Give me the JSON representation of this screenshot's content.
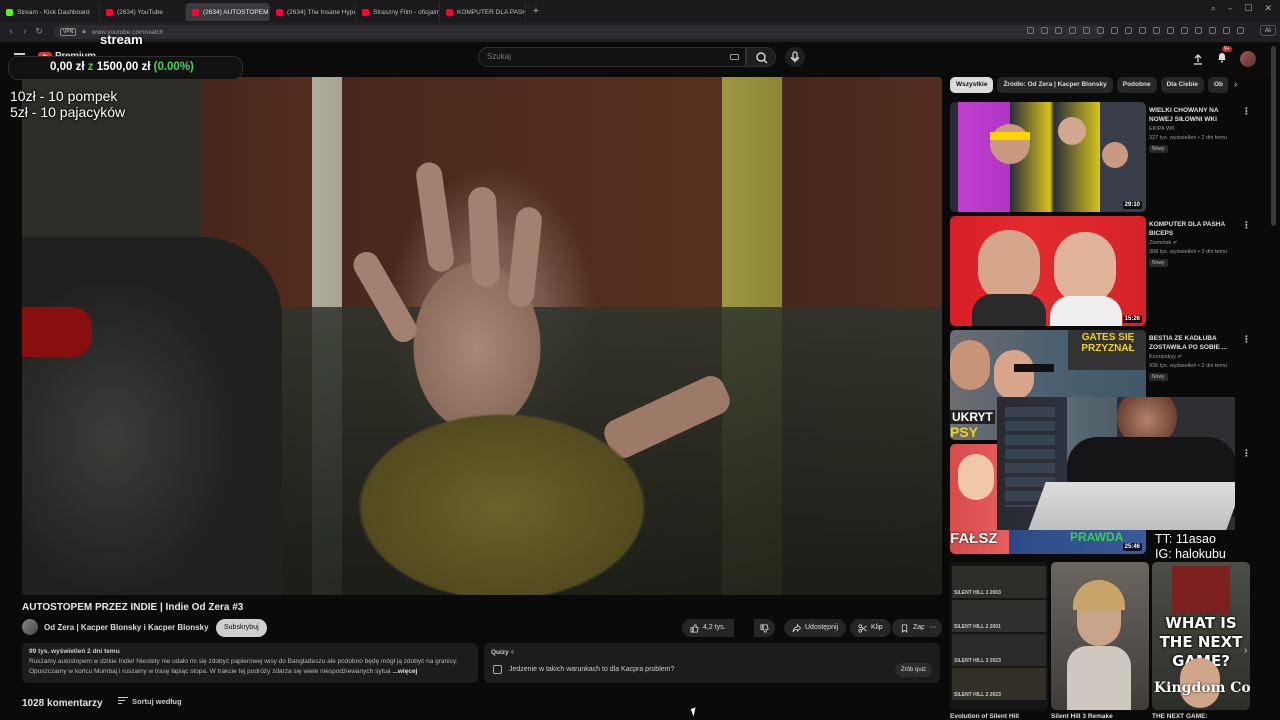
{
  "browser": {
    "tabs": [
      {
        "label": "Stream - Kick Dashboard",
        "color": "#53fc18",
        "active": false
      },
      {
        "label": "(2634) YouTube",
        "color": "#ff0033",
        "active": false
      },
      {
        "label": "(2634) AUTOSTOPEM",
        "color": "#ff0033",
        "active": true
      },
      {
        "label": "(2634) The Insane Hype o",
        "color": "#ff0033",
        "active": false
      },
      {
        "label": "Straszny Film - oficjalny z",
        "color": "#ff0033",
        "active": false
      },
      {
        "label": "KOMPUTER DLA PASHA I",
        "color": "#ff0033",
        "active": false
      }
    ],
    "url": "www.youtube.com/watch",
    "vpn_label": "VPN",
    "ai_label": "AI"
  },
  "header": {
    "logo_text": "Premium",
    "search_placeholder": "Szukaj",
    "notification_count": "9+"
  },
  "overlay": {
    "title": "stream",
    "amount": "0,00 zł",
    "separator": "z",
    "goal": "1500,00 zł",
    "percent": "(0.00%)",
    "rules": [
      "10zł - 10 pompek",
      "5zł - 10 pajacyków"
    ],
    "socials": [
      "TT: 11asao",
      "IG: halokubu"
    ]
  },
  "video": {
    "title": "AUTOSTOPEM PRZEZ INDIE | Indie Od Zera #3",
    "channel": "Od Zera | Kacper Blonsky i Kacper Blonsky",
    "subscribe_label": "Subskrybuj",
    "likes": "4,2 tys.",
    "share_label": "Udostępnij",
    "clip_label": "Klip",
    "save_label": "Zapisz",
    "more_label": "⋯"
  },
  "description": {
    "meta": "99 tys. wyświetleń  2 dni temu",
    "text": "Ruszamy autostopem w dzikie Indie! Niestety nie udało mi się zdobyć papierowej wisy do Bangladeszu ale podobno będę mógł ją zdobyć na granicy. Opuszczamy w końcu Mumbaj i ruszamy w trasę łapiąc stopa. W trakcie tej podróży zdarza się wiele niespodziewanych sytua",
    "more": "...więcej"
  },
  "quiz": {
    "label": "Quizy",
    "count": "4",
    "question": "Jedzenie w takich warunkach to dla Kacpra problem?",
    "button": "Zrób quiz"
  },
  "comments": {
    "count_label": "1028 komentarzy",
    "sort_label": "Sortuj według"
  },
  "sidebar": {
    "chips": [
      "Wszystkie",
      "Źródło: Od Zera | Kacper Blonsky",
      "Podobne",
      "Dla Ciebie",
      "Ob"
    ],
    "recommendations": [
      {
        "title": "WIELKI CHOWANY NA NOWEJ SIŁOWNI WKI",
        "channel": "EKIPA WK",
        "views": "327 tys. wyświetleń • 2 dni temu",
        "badge": "Nowy",
        "duration": "29:10"
      },
      {
        "title": "KOMPUTER DLA PASHA BICEPS",
        "channel": "Ziemniak",
        "views": "308 tys. wyświetleń • 3 dni temu",
        "badge": "Nowy",
        "duration": "15:26"
      },
      {
        "title": "BESTIA ZE KADŁUBA ZOSTAWIŁA PO SOBIE ...",
        "channel": "Konopskyy",
        "views": "936 tys. wyświetleń • 2 dni temu",
        "badge": "Nowy",
        "duration": ""
      },
      {
        "title": "",
        "channel": "",
        "views": "",
        "badge": "",
        "duration": "25:46"
      }
    ],
    "thumb_texts": {
      "gates": "GATES SIĘ PRZYZNAŁ",
      "ukryt": "UKRYT",
      "psy": "PSY",
      "falsz": "FAŁSZ",
      "prawda": "PRAWDA"
    },
    "shorts": [
      {
        "title": "Evolution of Silent Hill",
        "labels": [
          "SILENT HILL 3 2003",
          "SILENT HILL 2 2001",
          "SILENT HILL 3 2023",
          "SILENT HILL 2 2023"
        ]
      },
      {
        "title": "Silent Hill 3 Remake",
        "labels": []
      },
      {
        "title": "THE NEXT GAME:",
        "labels": [],
        "overlay": "WHAT IS THE NEXT GAME?",
        "bottom": "Kingdom Come"
      }
    ]
  }
}
